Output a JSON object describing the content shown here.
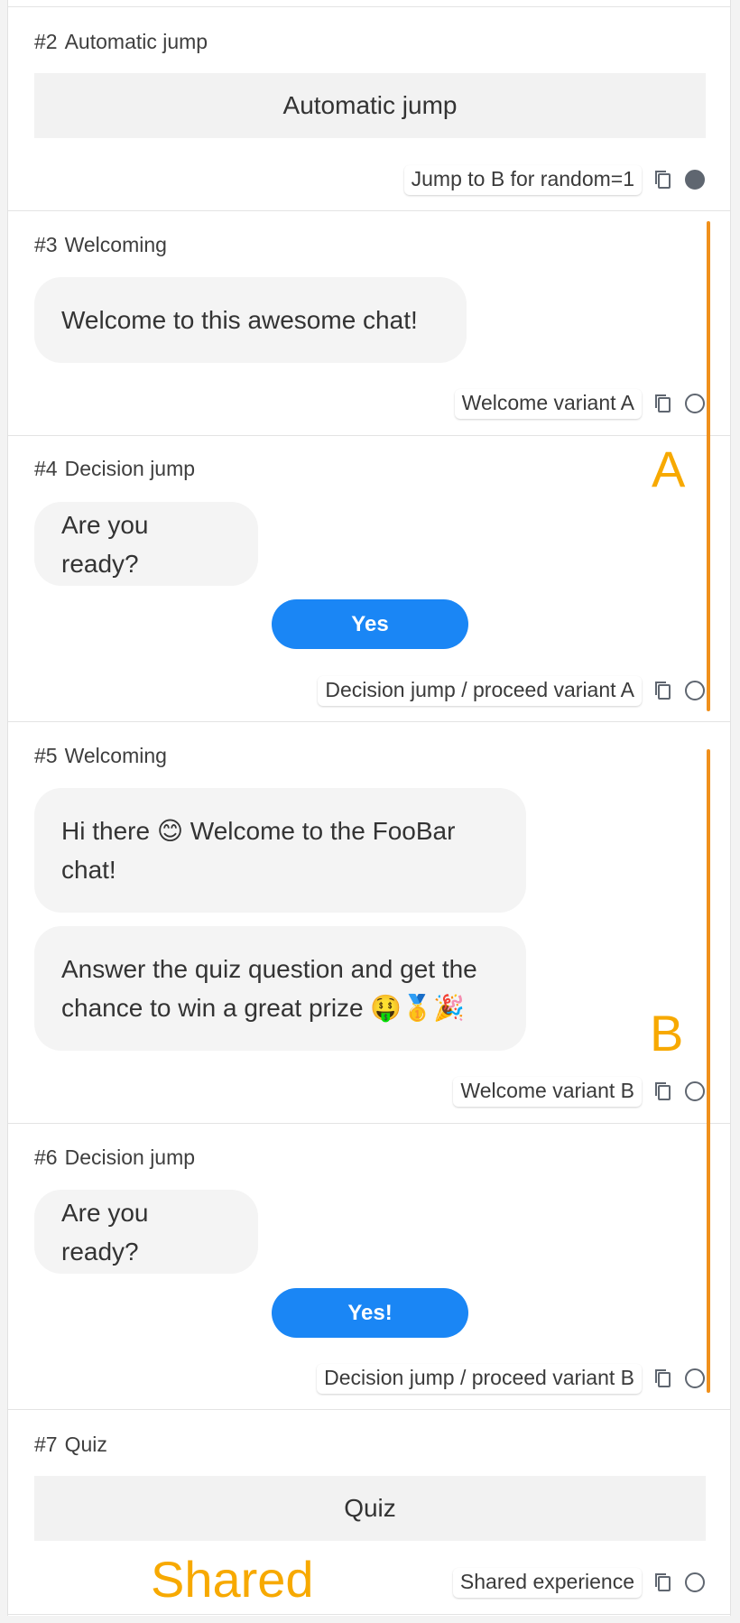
{
  "nodes": [
    {
      "number": "#2",
      "title": "Automatic jump",
      "block_text": "Automatic jump",
      "variant_label": "Jump to B for random=1",
      "selected": true
    },
    {
      "number": "#3",
      "title": "Welcoming",
      "bubbles": [
        "Welcome to this awesome chat!"
      ],
      "variant_label": "Welcome variant A",
      "selected": false
    },
    {
      "number": "#4",
      "title": "Decision jump",
      "bubbles": [
        "Are you ready?"
      ],
      "button_label": "Yes",
      "variant_label": "Decision jump / proceed variant A",
      "selected": false
    },
    {
      "number": "#5",
      "title": "Welcoming",
      "bubbles": [
        "Hi there 😊 Welcome to the FooBar chat!",
        "Answer the quiz question and get the chance to win a great prize 🤑🥇🎉"
      ],
      "variant_label": "Welcome variant B",
      "selected": false
    },
    {
      "number": "#6",
      "title": "Decision jump",
      "bubbles": [
        "Are you ready?"
      ],
      "button_label": "Yes!",
      "variant_label": "Decision jump / proceed variant B",
      "selected": false
    },
    {
      "number": "#7",
      "title": "Quiz",
      "block_text": "Quiz",
      "variant_label": "Shared experience",
      "selected": false
    }
  ],
  "annotations": {
    "group_a": "A",
    "group_b": "B",
    "shared": "Shared",
    "color": "#f7a900",
    "bar_color": "#f0901c"
  },
  "colors": {
    "button": "#1a86f5",
    "bubble": "#f4f4f4"
  },
  "icons": {
    "copy": "copy-icon",
    "radio": "radio-icon"
  }
}
